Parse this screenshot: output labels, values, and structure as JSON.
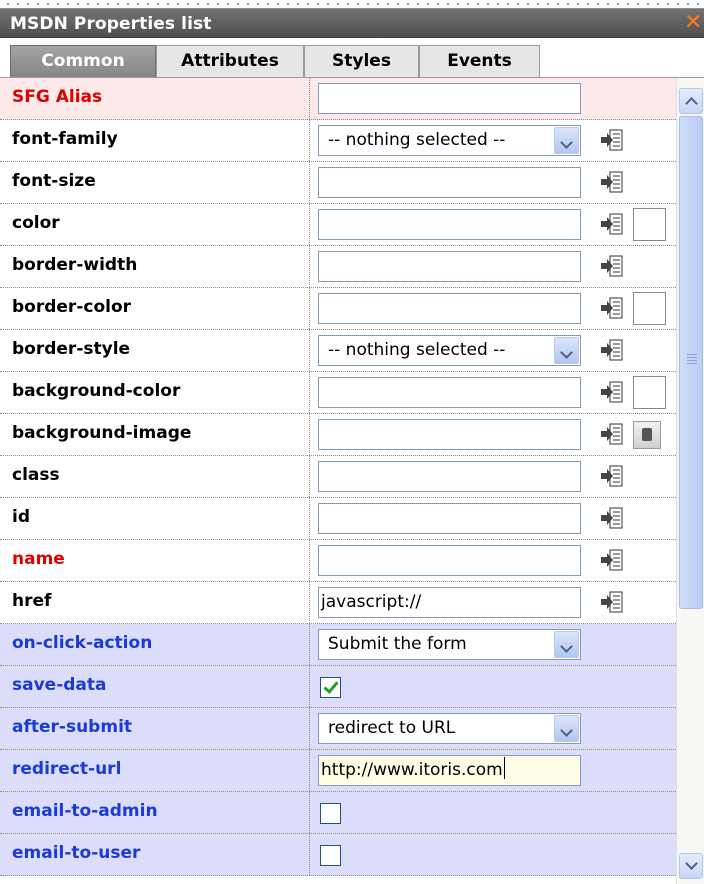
{
  "window": {
    "title": "MSDN Properties list",
    "close_icon": "close-x-icon"
  },
  "tabs": [
    {
      "label": "Common",
      "active": true
    },
    {
      "label": "Attributes",
      "active": false
    },
    {
      "label": "Styles",
      "active": false
    },
    {
      "label": "Events",
      "active": false
    }
  ],
  "rows": [
    {
      "label": "SFG Alias",
      "control": "text",
      "value": ""
    },
    {
      "label": "font-family",
      "control": "select",
      "value": "-- nothing selected --"
    },
    {
      "label": "font-size",
      "control": "text",
      "value": ""
    },
    {
      "label": "color",
      "control": "text",
      "value": ""
    },
    {
      "label": "border-width",
      "control": "text",
      "value": ""
    },
    {
      "label": "border-color",
      "control": "text",
      "value": ""
    },
    {
      "label": "border-style",
      "control": "select",
      "value": "-- nothing selected --"
    },
    {
      "label": "background-color",
      "control": "text",
      "value": ""
    },
    {
      "label": "background-image",
      "control": "text",
      "value": ""
    },
    {
      "label": "class",
      "control": "text",
      "value": ""
    },
    {
      "label": "id",
      "control": "text",
      "value": ""
    },
    {
      "label": "name",
      "control": "text",
      "value": ""
    },
    {
      "label": "href",
      "control": "text",
      "value": "javascript://"
    },
    {
      "label": "on-click-action",
      "control": "select",
      "value": "Submit the form"
    },
    {
      "label": "save-data",
      "control": "checkbox",
      "checked": true
    },
    {
      "label": "after-submit",
      "control": "select",
      "value": "redirect to URL"
    },
    {
      "label": "redirect-url",
      "control": "text",
      "value": "http://www.itoris.com"
    },
    {
      "label": "email-to-admin",
      "control": "checkbox",
      "checked": false
    },
    {
      "label": "email-to-user",
      "control": "checkbox",
      "checked": false
    }
  ],
  "colors": {
    "required_label": "#e00000",
    "form_label": "#1a3bd6",
    "required_row_bg": "#fde9ea",
    "form_row_bg": "#dcdcfb",
    "close_icon": "#ff7a1a"
  },
  "icons": {
    "property_action": "property-inherit-icon",
    "color_swatch": "color-swatch",
    "image_picker": "image-picker-icon",
    "dropdown": "chevron-down-icon",
    "scroll_up": "scroll-up-icon",
    "scroll_down": "scroll-down-icon"
  }
}
